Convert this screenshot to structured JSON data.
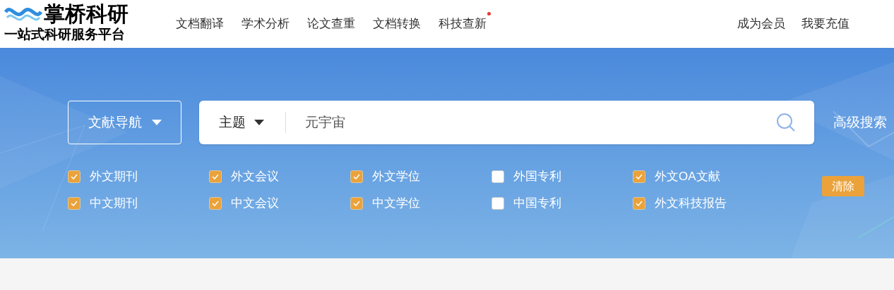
{
  "logo": {
    "name": "掌桥科研",
    "tagline": "一站式科研服务平台"
  },
  "nav": [
    {
      "label": "文档翻译",
      "dot": false
    },
    {
      "label": "学术分析",
      "dot": false
    },
    {
      "label": "论文查重",
      "dot": false
    },
    {
      "label": "文档转换",
      "dot": false
    },
    {
      "label": "科技查新",
      "dot": true
    }
  ],
  "account_links": [
    "成为会员",
    "我要充值"
  ],
  "search": {
    "nav_button": "文献导航",
    "field_type": "主题",
    "value": "元宇宙",
    "advanced": "高级搜索"
  },
  "sources": [
    {
      "label": "外文期刊",
      "checked": true
    },
    {
      "label": "外文会议",
      "checked": true
    },
    {
      "label": "外文学位",
      "checked": true
    },
    {
      "label": "外国专利",
      "checked": false
    },
    {
      "label": "外文OA文献",
      "checked": true
    },
    {
      "label": "中文期刊",
      "checked": true
    },
    {
      "label": "中文会议",
      "checked": true
    },
    {
      "label": "中文学位",
      "checked": true
    },
    {
      "label": "中国专利",
      "checked": false
    },
    {
      "label": "外文科技报告",
      "checked": true
    }
  ],
  "clear_button": "清除"
}
